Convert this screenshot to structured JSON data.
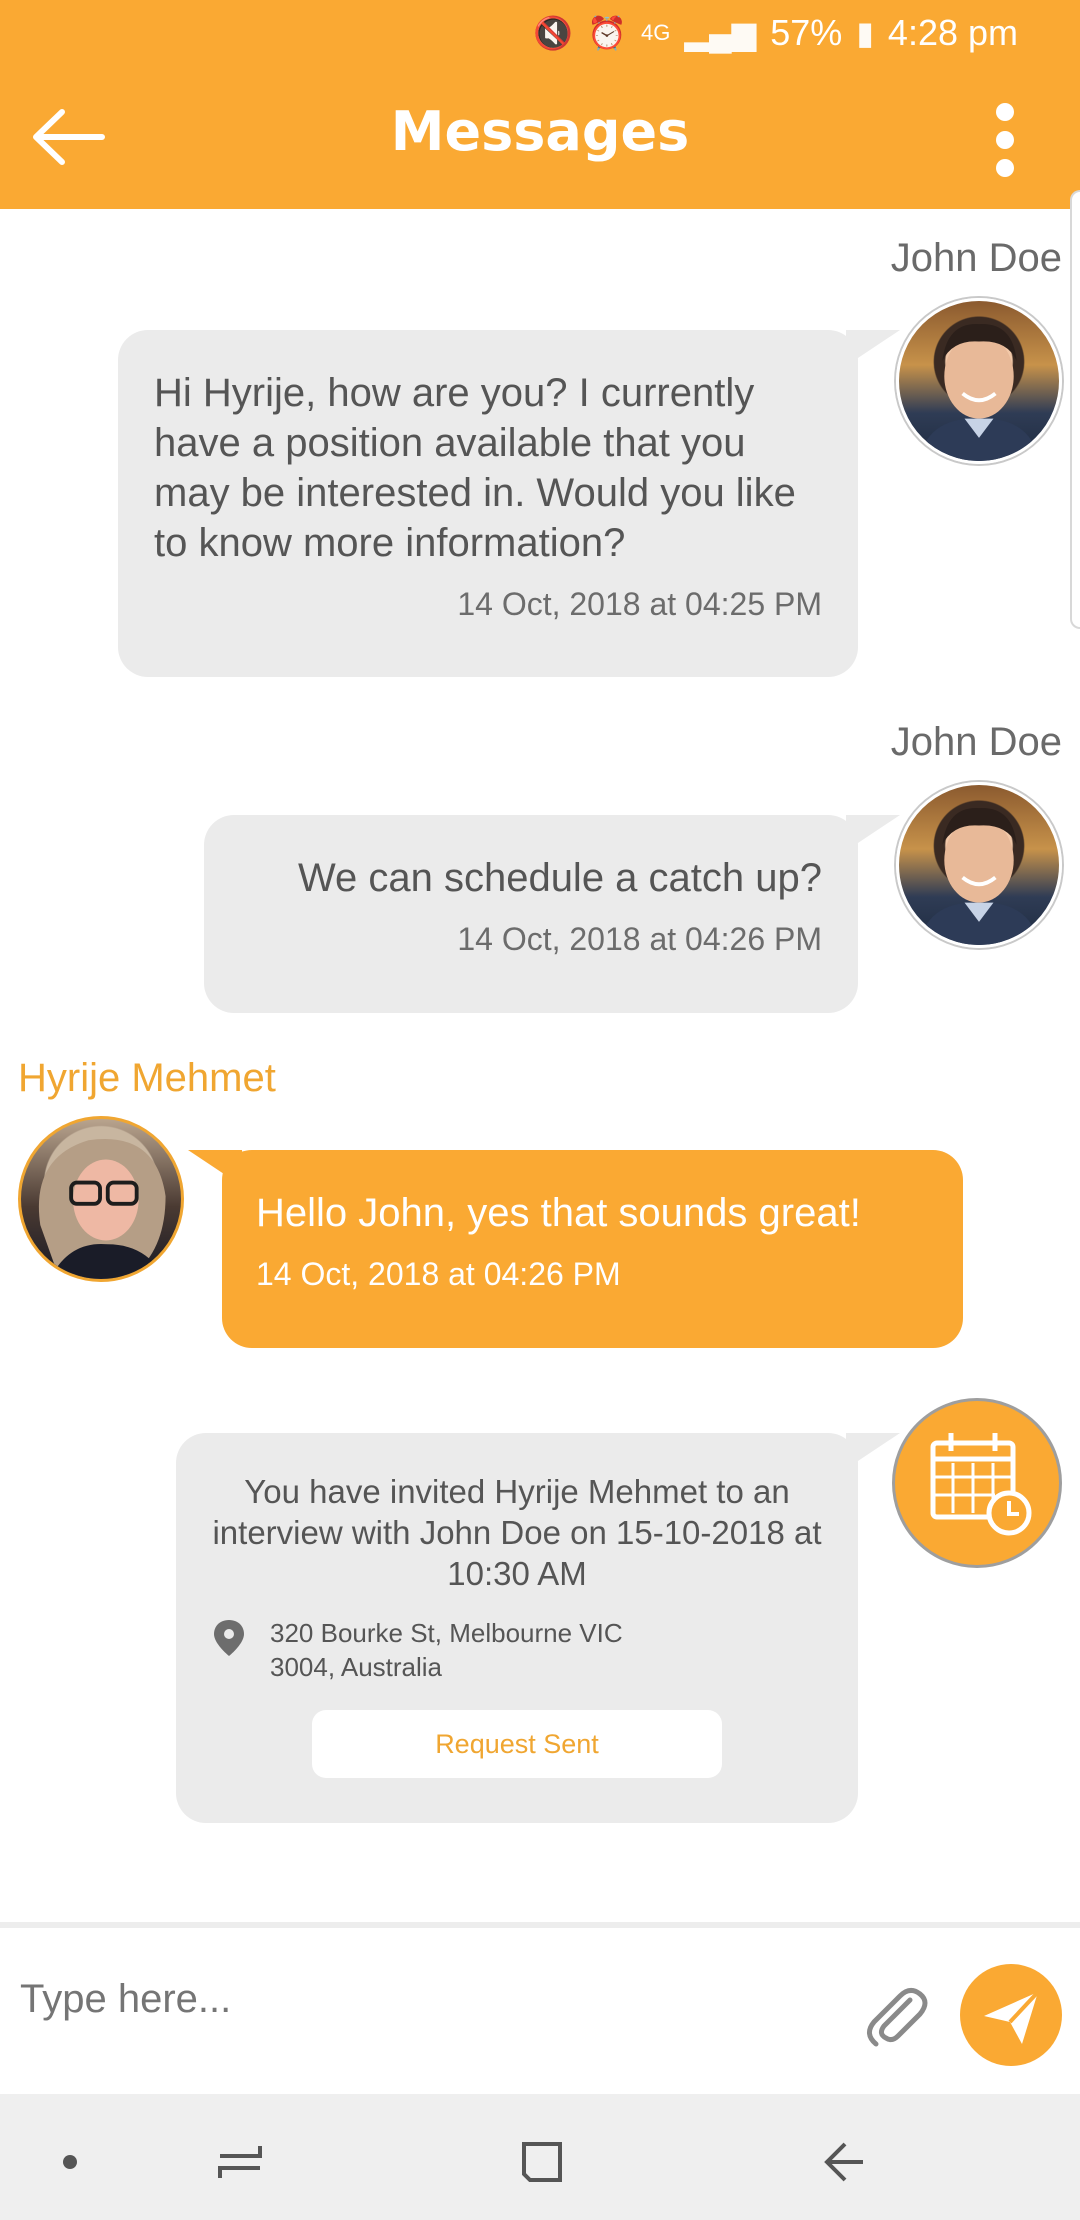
{
  "status_bar": {
    "battery": "57%",
    "time": "4:28 pm",
    "network": "4G"
  },
  "app_bar": {
    "title": "Messages"
  },
  "messages": [
    {
      "sender": "John Doe",
      "text": "Hi Hyrije, how are you? I currently have a position available that you may be interested in.  Would you like to know more information?",
      "time": "14 Oct, 2018 at 04:25 PM"
    },
    {
      "sender": "John Doe",
      "text": "We can schedule a catch up?",
      "time": "14 Oct, 2018 at 04:26 PM"
    },
    {
      "sender": "Hyrije Mehmet",
      "text": "Hello John, yes that sounds great!",
      "time": "14 Oct, 2018 at 04:26 PM"
    }
  ],
  "invite": {
    "description": "You have invited Hyrije Mehmet to an interview with John Doe on 15-10-2018 at 10:30 AM",
    "address_line1": "320 Bourke St, Melbourne VIC",
    "address_line2": "3004, Australia",
    "status_button": "Request Sent"
  },
  "composer": {
    "placeholder": "Type here..."
  },
  "colors": {
    "accent": "#faa933",
    "bubble_grey": "#ebebeb",
    "text_grey": "#555555"
  },
  "icons": [
    "back-arrow-icon",
    "more-vert-icon",
    "location-pin-icon",
    "calendar-clock-icon",
    "attachment-icon",
    "send-icon"
  ]
}
